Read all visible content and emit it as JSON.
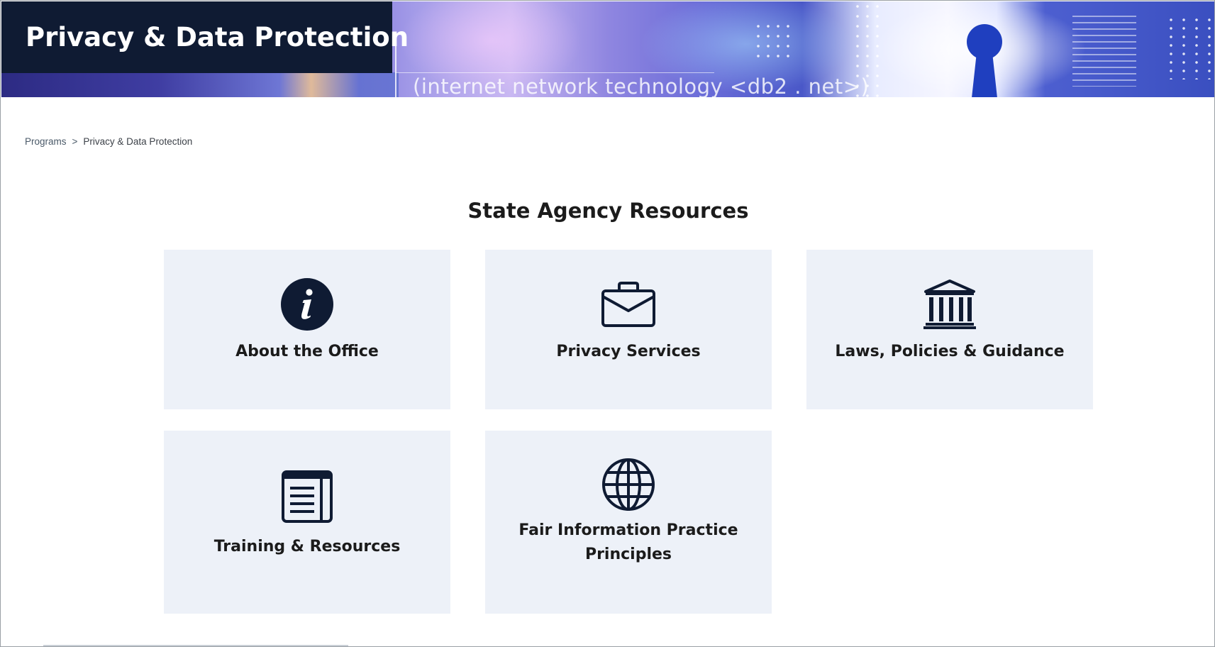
{
  "hero": {
    "title": "Privacy & Data Protection",
    "tagline": "(internet network technology <db2 . net>)"
  },
  "breadcrumb": {
    "items": [
      "Programs",
      "Privacy & Data Protection"
    ],
    "separator": ">"
  },
  "section": {
    "title": "State Agency Resources",
    "cards": [
      {
        "label": "About the Office",
        "icon": "info-icon"
      },
      {
        "label": "Privacy Services",
        "icon": "briefcase-icon"
      },
      {
        "label": "Laws, Policies & Guidance",
        "icon": "courthouse-icon"
      },
      {
        "label": "Training & Resources",
        "icon": "document-icon"
      },
      {
        "label": "Fair Information Practice Principles",
        "icon": "globe-icon"
      }
    ]
  },
  "colors": {
    "title_bg": "#0f1b33",
    "card_bg": "#edf1f8",
    "icon": "#0f1b33",
    "text": "#1b1b1b"
  }
}
